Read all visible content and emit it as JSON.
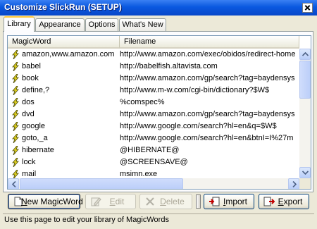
{
  "window": {
    "title": "Customize SlickRun (SETUP)"
  },
  "tabs": [
    {
      "label": "Library",
      "active": true
    },
    {
      "label": "Appearance",
      "active": false
    },
    {
      "label": "Options",
      "active": false
    },
    {
      "label": "What's New",
      "active": false
    }
  ],
  "list": {
    "headers": {
      "magicword": "MagicWord",
      "filename": "Filename"
    },
    "rows": [
      {
        "magicword": "amazon,www.amazon.com",
        "filename": "http://www.amazon.com/exec/obidos/redirect-home"
      },
      {
        "magicword": "babel",
        "filename": "http://babelfish.altavista.com"
      },
      {
        "magicword": "book",
        "filename": "http://www.amazon.com/gp/search?tag=baydensys"
      },
      {
        "magicword": "define,?",
        "filename": "http://www.m-w.com/cgi-bin/dictionary?$W$"
      },
      {
        "magicword": "dos",
        "filename": "%comspec%"
      },
      {
        "magicword": "dvd",
        "filename": "http://www.amazon.com/gp/search?tag=baydensys"
      },
      {
        "magicword": "google",
        "filename": "http://www.google.com/search?hl=en&q=$W$"
      },
      {
        "magicword": "goto,_a",
        "filename": "http://www.google.com/search?hl=en&btnI=I%27m"
      },
      {
        "magicword": "hibernate",
        "filename": "@HIBERNATE@"
      },
      {
        "magicword": "lock",
        "filename": "@SCREENSAVE@"
      },
      {
        "magicword": "mail",
        "filename": "msimn.exe"
      }
    ],
    "row_icon": "lightning-bolt-icon"
  },
  "buttons": {
    "new": {
      "mnemonic": "N",
      "rest": "ew MagicWord"
    },
    "edit": {
      "mnemonic": "E",
      "rest": "dit"
    },
    "delete": {
      "mnemonic": "D",
      "rest": "elete"
    },
    "import": {
      "mnemonic": "I",
      "rest": "mport"
    },
    "export": {
      "mnemonic": "E",
      "rest": "xport"
    }
  },
  "status": {
    "text": "Use this page to edit your library of MagicWords"
  },
  "colors": {
    "titlebar": "#0a58e0",
    "accent_tab": "#ffc83c",
    "dialog_bg": "#ece9d8"
  }
}
